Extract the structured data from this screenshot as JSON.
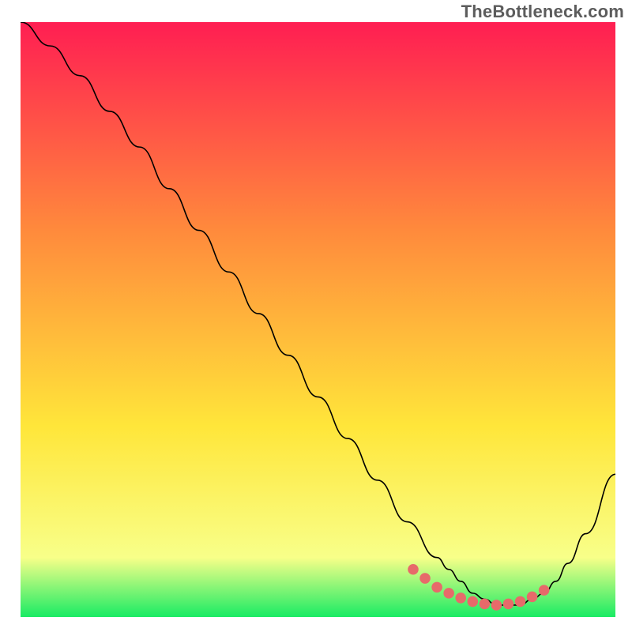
{
  "watermark": "TheBottleneck.com",
  "colors": {
    "grad_top": "#ff1e52",
    "grad_mid1": "#ff8a3c",
    "grad_mid2": "#ffe63a",
    "grad_mid3": "#f8ff89",
    "grad_bottom": "#19eb64",
    "curve": "#000000",
    "dots": "#e76a6a"
  },
  "chart_data": {
    "type": "line",
    "title": "",
    "xlabel": "",
    "ylabel": "",
    "xlim": [
      0,
      100
    ],
    "ylim": [
      0,
      100
    ],
    "series": [
      {
        "name": "bottleneck-curve",
        "x": [
          0,
          5,
          10,
          15,
          20,
          25,
          30,
          35,
          40,
          45,
          50,
          55,
          60,
          65,
          70,
          72,
          74,
          76,
          78,
          80,
          82,
          84,
          86,
          88,
          90,
          92,
          95,
          100
        ],
        "y": [
          100,
          96,
          91,
          85,
          79,
          72,
          65,
          58,
          51,
          44,
          37,
          30,
          23,
          16,
          10,
          8,
          6,
          4,
          3,
          2,
          2,
          2,
          3,
          4,
          6,
          9,
          14,
          24
        ]
      }
    ],
    "optimal_range_markers": {
      "x": [
        66,
        68,
        70,
        72,
        74,
        76,
        78,
        80,
        82,
        84,
        86,
        88
      ],
      "y": [
        8,
        6.5,
        5,
        4,
        3.2,
        2.6,
        2.2,
        2.0,
        2.2,
        2.6,
        3.4,
        4.5
      ]
    }
  }
}
